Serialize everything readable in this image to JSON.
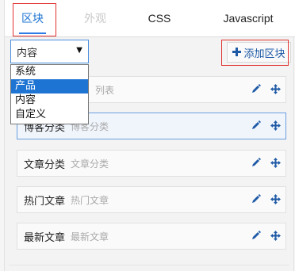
{
  "tabs": [
    {
      "label": "区块",
      "state": "active"
    },
    {
      "label": "外观",
      "state": "disabled"
    },
    {
      "label": "CSS",
      "state": "normal"
    },
    {
      "label": "Javascript",
      "state": "normal"
    }
  ],
  "select": {
    "value": "内容",
    "arrow": "▼",
    "options": [
      "系统",
      "产品",
      "内容",
      "自定义"
    ],
    "highlighted": "产品"
  },
  "add_button": {
    "icon": "plus-icon",
    "label": "添加区块"
  },
  "blocks": [
    {
      "title": "",
      "desc": "列表",
      "highlight": false
    },
    {
      "title": "博客分类",
      "desc": "博客分类",
      "highlight": true
    },
    {
      "title": "文章分类",
      "desc": "文章分类",
      "highlight": false
    },
    {
      "title": "热门文章",
      "desc": "热门文章",
      "highlight": false
    },
    {
      "title": "最新文章",
      "desc": "最新文章",
      "highlight": false
    }
  ],
  "colors": {
    "accent": "#1e74d3",
    "annotation": "#e0322f",
    "icon": "#1f5aa6"
  }
}
